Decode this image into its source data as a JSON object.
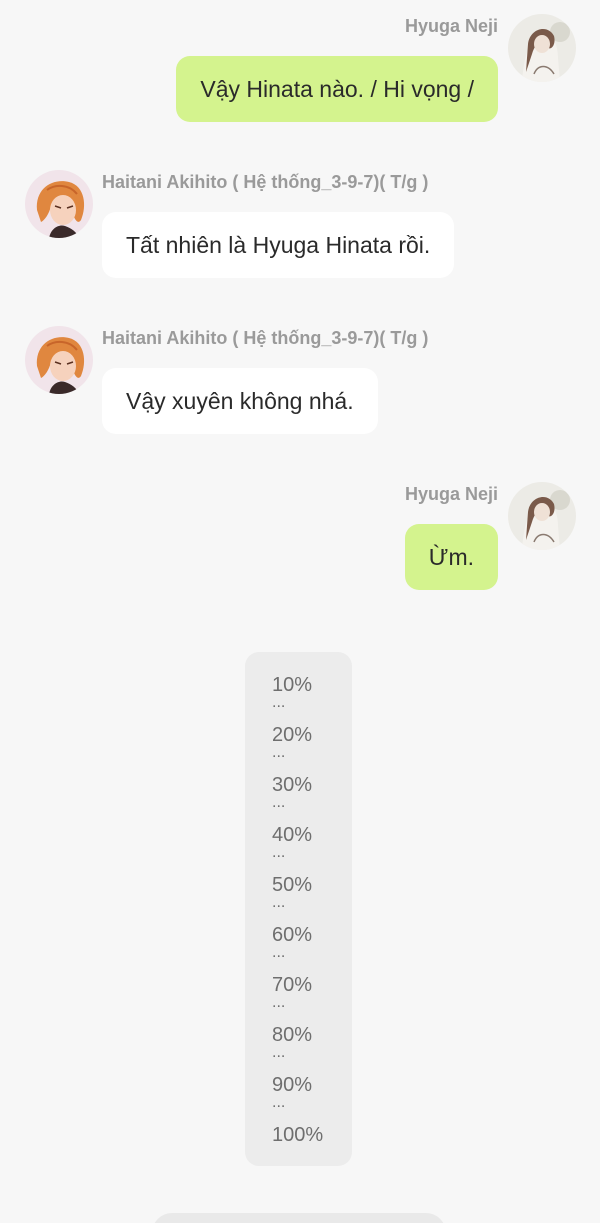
{
  "messages": [
    {
      "sender": "Hyuga Neji",
      "text": "Vậy Hinata nào. / Hi vọng /"
    },
    {
      "sender": "Haitani Akihito ( Hệ thống_3-9-7)( T/g )",
      "text": "Tất nhiên là Hyuga Hinata rồi."
    },
    {
      "sender": "Haitani Akihito ( Hệ thống_3-9-7)( T/g )",
      "text": "Vậy xuyên không nhá."
    },
    {
      "sender": "Hyuga Neji",
      "text": "Ừm."
    }
  ],
  "progress": {
    "steps": [
      "10%",
      "20%",
      "30%",
      "40%",
      "50%",
      "60%",
      "70%",
      "80%",
      "90%",
      "100%"
    ],
    "separator": "..."
  },
  "colors": {
    "my_bubble": "#d4f38e",
    "their_bubble": "#ffffff",
    "background": "#f7f7f7"
  }
}
